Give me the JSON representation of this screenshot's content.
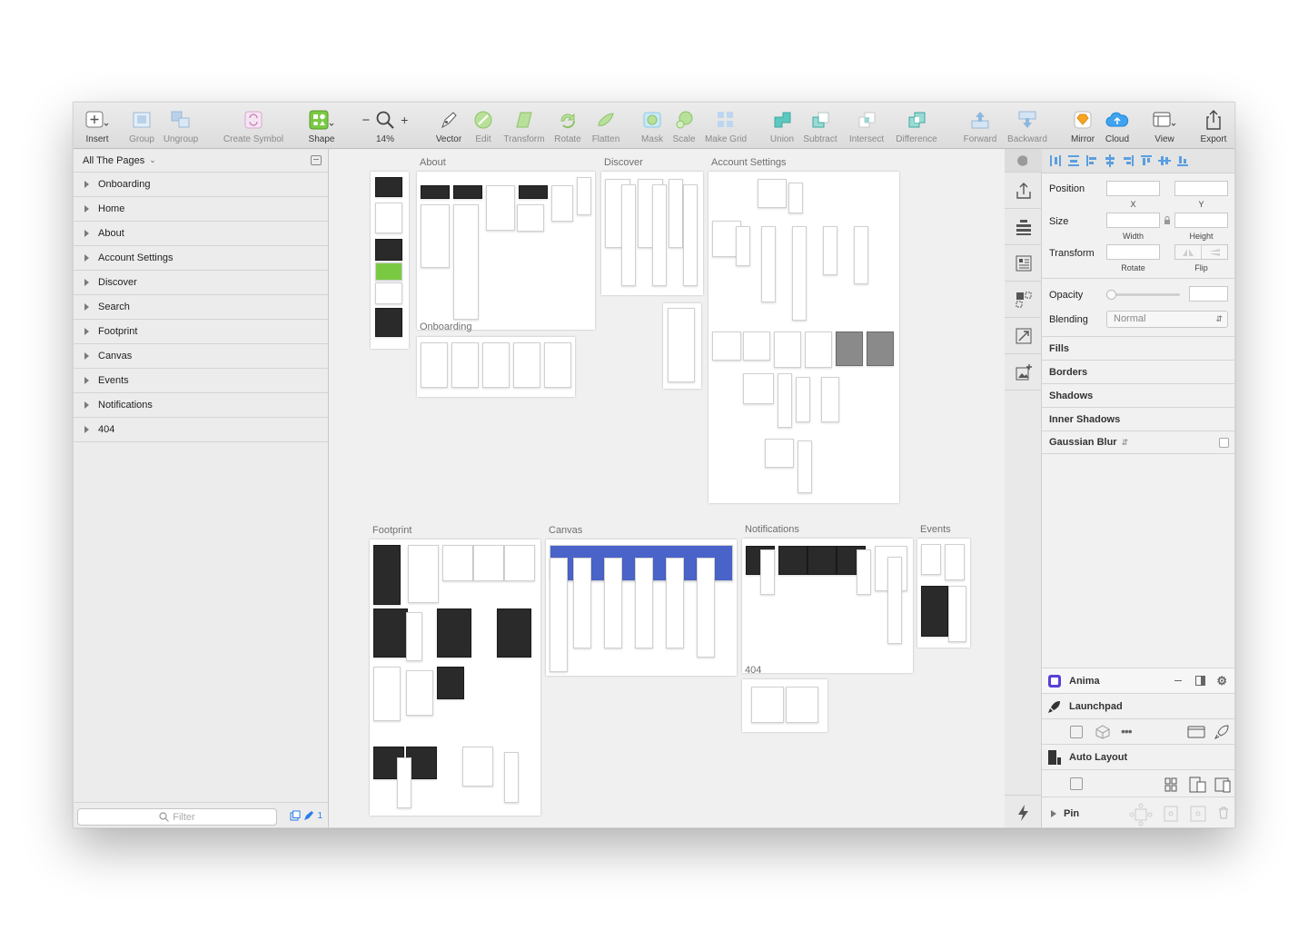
{
  "toolbar": {
    "insert": "Insert",
    "group": "Group",
    "ungroup": "Ungroup",
    "create_symbol": "Create Symbol",
    "shape": "Shape",
    "zoom": "14%",
    "vector": "Vector",
    "edit": "Edit",
    "transform": "Transform",
    "rotate": "Rotate",
    "flatten": "Flatten",
    "mask": "Mask",
    "scale": "Scale",
    "make_grid": "Make Grid",
    "union": "Union",
    "subtract": "Subtract",
    "intersect": "Intersect",
    "difference": "Difference",
    "forward": "Forward",
    "backward": "Backward",
    "mirror": "Mirror",
    "cloud": "Cloud",
    "view": "View",
    "export": "Export",
    "zoom_minus": "−",
    "zoom_plus": "+"
  },
  "layers": {
    "pages_title": "All The Pages",
    "pages": [
      "Onboarding",
      "Home",
      "About",
      "Account Settings",
      "Discover",
      "Search",
      "Footprint",
      "Canvas",
      "Events",
      "Notifications",
      "404"
    ],
    "filter_placeholder": "Filter",
    "footer_count": "1"
  },
  "canvas": {
    "titles": {
      "about": "About",
      "discover": "Discover",
      "account_settings": "Account Settings",
      "onboarding": "Onboarding",
      "footprint": "Footprint",
      "canvas": "Canvas",
      "notifications": "Notifications",
      "events": "Events",
      "not_found": "404"
    }
  },
  "inspector": {
    "position": "Position",
    "x": "X",
    "y": "Y",
    "size": "Size",
    "width": "Width",
    "height": "Height",
    "transform": "Transform",
    "rotate": "Rotate",
    "flip": "Flip",
    "opacity": "Opacity",
    "blending": "Blending",
    "blending_value": "Normal",
    "fills": "Fills",
    "borders": "Borders",
    "shadows": "Shadows",
    "inner_shadows": "Inner Shadows",
    "gaussian_blur": "Gaussian Blur",
    "anima": "Anima",
    "launchpad": "Launchpad",
    "auto_layout": "Auto Layout",
    "pin": "Pin"
  },
  "colors": {
    "accent_blue": "#2b7de9",
    "shape_green": "#7ac943",
    "sketch_orange": "#f5a623",
    "boolean_teal": "#5cc8c0"
  }
}
